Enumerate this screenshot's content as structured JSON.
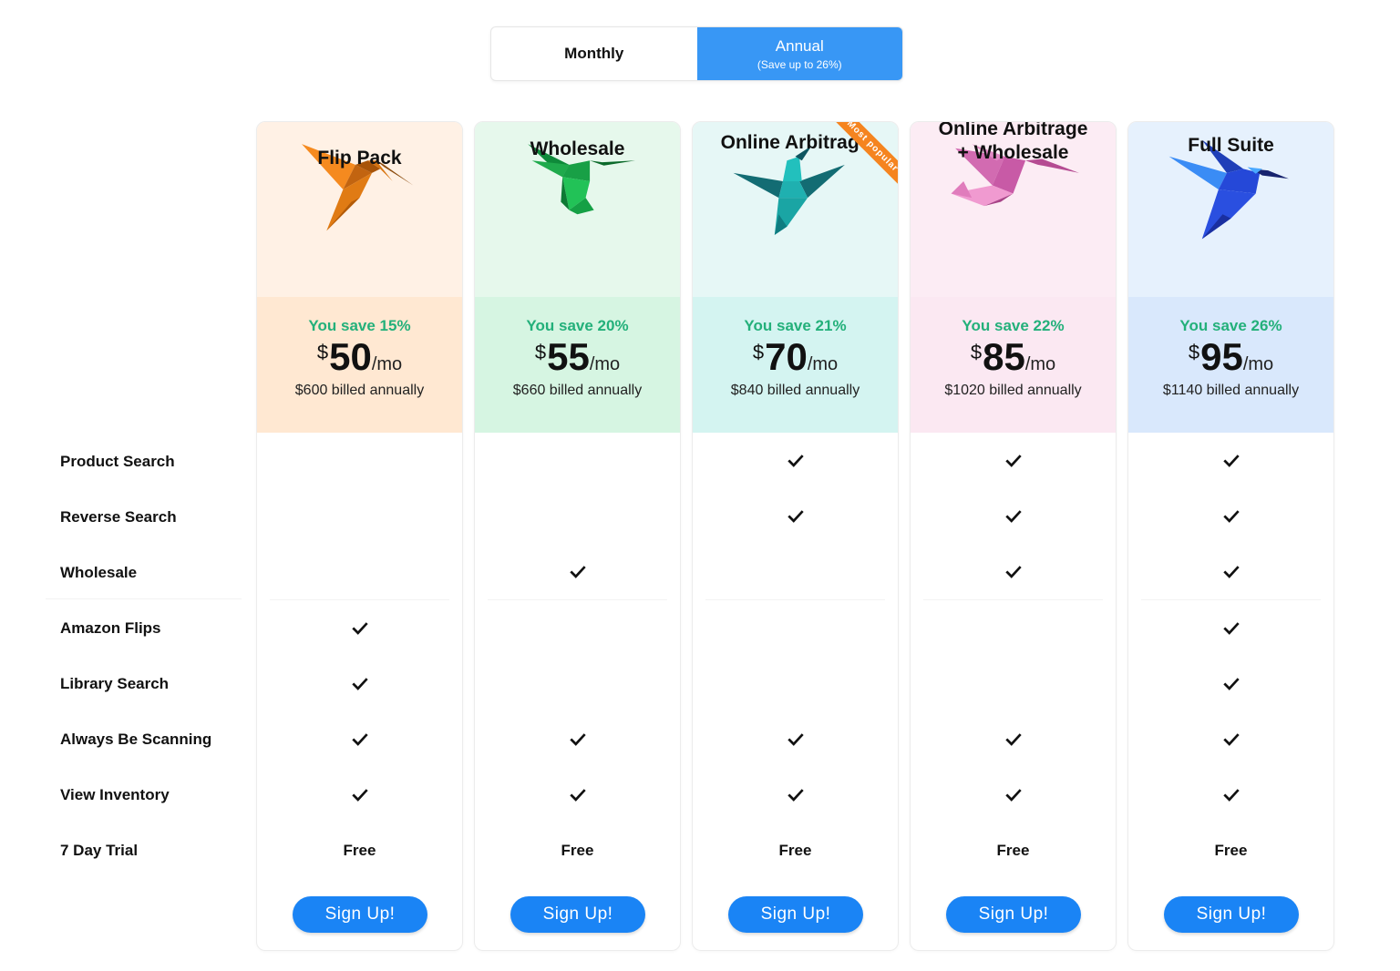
{
  "billing_toggle": {
    "monthly_label": "Monthly",
    "annual_label": "Annual",
    "annual_sublabel": "(Save up to 26%)",
    "selected": "Annual",
    "accent_color": "#3897f5"
  },
  "features": [
    "Product Search",
    "Reverse Search",
    "Wholesale",
    "Amazon Flips",
    "Library Search",
    "Always Be Scanning",
    "View Inventory",
    "7 Day Trial"
  ],
  "plans": [
    {
      "name": "Flip Pack",
      "icon": "orange-hummingbird-icon",
      "head_color": "#fff1e5",
      "price_color": "#ffe8d2",
      "save_text": "You save 15%",
      "currency": "$",
      "price": "50",
      "period": "/mo",
      "billed": "$600 billed annually",
      "features": [
        "",
        "",
        "",
        "check",
        "check",
        "check",
        "check",
        "Free"
      ],
      "cta": "Sign Up!"
    },
    {
      "name": "Wholesale",
      "icon": "green-hummingbird-icon",
      "head_color": "#e6f8ec",
      "price_color": "#d6f5e2",
      "save_text": "You save 20%",
      "currency": "$",
      "price": "55",
      "period": "/mo",
      "billed": "$660 billed annually",
      "features": [
        "",
        "",
        "check",
        "",
        "",
        "check",
        "check",
        "Free"
      ],
      "cta": "Sign Up!"
    },
    {
      "name": "Online Arbitrage",
      "icon": "teal-hummingbird-icon",
      "head_color": "#e6f7f6",
      "price_color": "#d4f4f1",
      "save_text": "You save 21%",
      "currency": "$",
      "price": "70",
      "period": "/mo",
      "billed": "$840 billed annually",
      "badge": "Most popular",
      "features": [
        "check",
        "check",
        "",
        "",
        "",
        "check",
        "check",
        "Free"
      ],
      "cta": "Sign Up!"
    },
    {
      "name": "Online Arbitrage + Wholesale",
      "name_lines": [
        "Online Arbitrage",
        "+ Wholesale"
      ],
      "icon": "pink-hummingbird-icon",
      "head_color": "#fcecf4",
      "price_color": "#fbe8f2",
      "save_text": "You save 22%",
      "currency": "$",
      "price": "85",
      "period": "/mo",
      "billed": "$1020 billed annually",
      "features": [
        "check",
        "check",
        "check",
        "",
        "",
        "check",
        "check",
        "Free"
      ],
      "cta": "Sign Up!"
    },
    {
      "name": "Full Suite",
      "icon": "blue-hummingbird-icon",
      "head_color": "#e6f1fd",
      "price_color": "#d9e8fc",
      "save_text": "You save 26%",
      "currency": "$",
      "price": "95",
      "period": "/mo",
      "billed": "$1140 billed annually",
      "features": [
        "check",
        "check",
        "check",
        "check",
        "check",
        "check",
        "check",
        "Free"
      ],
      "cta": "Sign Up!"
    }
  ]
}
